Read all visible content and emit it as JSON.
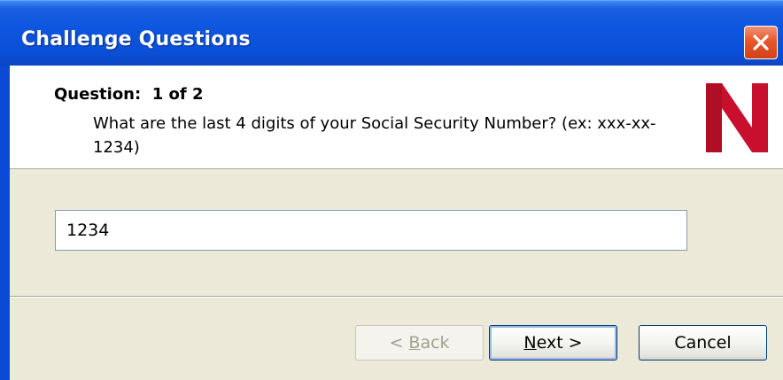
{
  "window": {
    "title": "Challenge Questions",
    "close_label": "Close"
  },
  "question": {
    "label": "Question:  1 of 2",
    "text": "What are the last 4 digits of your Social Security Number? (ex: xxx-xx-1234)"
  },
  "answer": {
    "value": "1234"
  },
  "buttons": {
    "back": {
      "prefix": "< ",
      "mnemonic": "B",
      "rest": "ack",
      "enabled": false
    },
    "next": {
      "prefix": "",
      "mnemonic": "N",
      "rest": "ext >"
    },
    "cancel": "Cancel"
  },
  "logo": {
    "icon": "novell-n-logo",
    "color": "#c8102e"
  },
  "colors": {
    "titlebar": "#0a4fd6",
    "dialog_bg": "#ece9d8",
    "close_button": "#e4582a"
  }
}
